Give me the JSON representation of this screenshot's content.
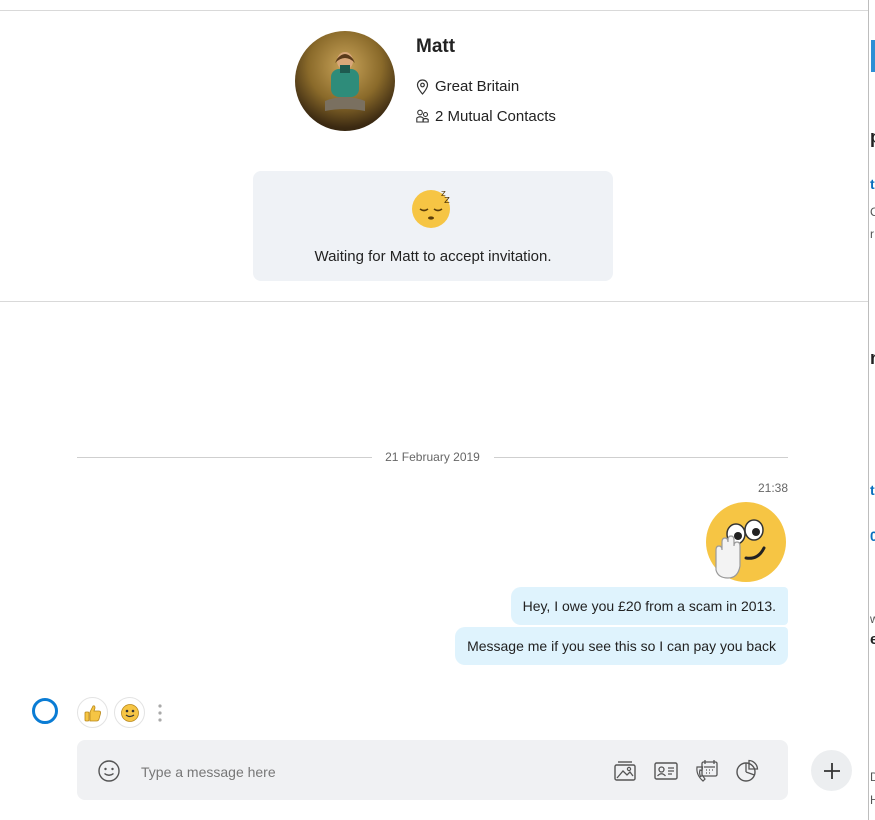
{
  "profile": {
    "name": "Matt",
    "location": "Great Britain",
    "mutual_contacts": "2 Mutual Contacts"
  },
  "invitation": {
    "text": "Waiting for Matt to accept invitation."
  },
  "conversation": {
    "date": "21 February 2019",
    "time": "21:38",
    "messages": [
      "Hey, I owe you £20 from a scam in 2013.",
      "Message me if you see this so I can pay you back"
    ]
  },
  "composer": {
    "placeholder": "Type a message here"
  },
  "colors": {
    "accent": "#0a7cd4",
    "bubble": "#dff3fd",
    "card": "#eff2f6",
    "composer": "#f0f1f3"
  },
  "right_panel": {
    "fragments": [
      "p",
      "t",
      "C",
      "r",
      "n",
      "t",
      "0",
      "w",
      "e",
      "D",
      "H"
    ]
  }
}
